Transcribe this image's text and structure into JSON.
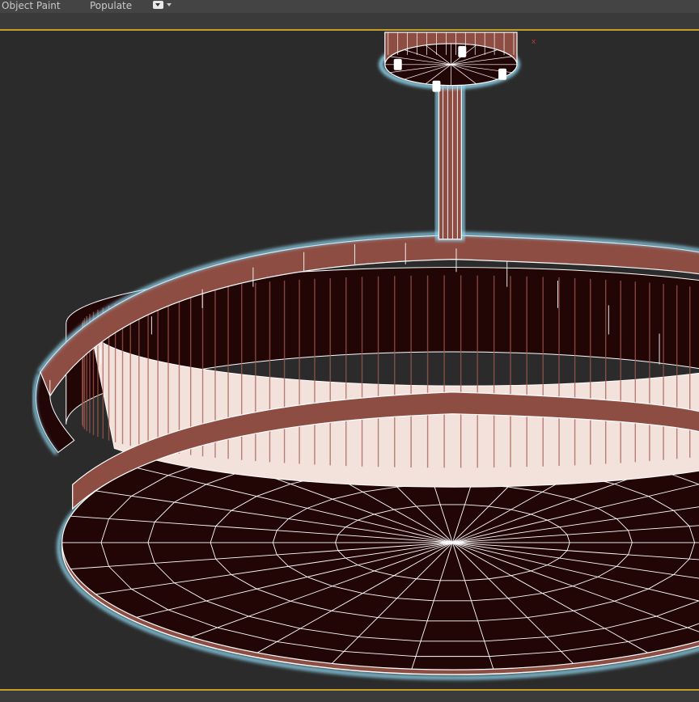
{
  "ribbon": {
    "tabs": [
      {
        "label": "Object Paint"
      },
      {
        "label": "Populate"
      }
    ],
    "toggle_icon": "dropdown-toggle-icon"
  },
  "viewport": {
    "background": "#2b2b2b",
    "active_border_color": "#c3a02e",
    "wire_color": "#ffffff",
    "mesh_fill_color": "#220606",
    "rim_fill_color": "#8e4d43",
    "selection_glow_color": "#8fd6ef",
    "axis_marker_color": "#cc3333",
    "object": "chandelier-wireframe"
  }
}
